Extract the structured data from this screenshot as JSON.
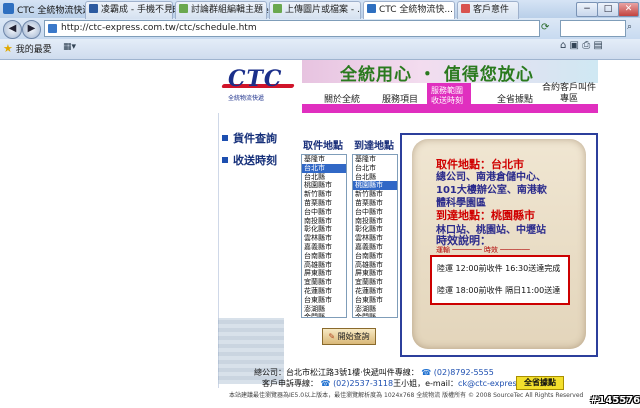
{
  "window": {
    "title": "CTC 全統物流快遞股份有限公司 - 收送時刻表 - Windows Internet Explorer",
    "controls": [
      "−",
      "□",
      "✕"
    ]
  },
  "address_bar": {
    "url": "http://ctc-express.com.tw/ctc/schedule.htm"
  },
  "favorites": {
    "label": "我的最愛"
  },
  "tabs": [
    {
      "label": "凌霸成 - 手機不見 ...",
      "color": "#2c5aa0"
    },
    {
      "label": "討論群組編輯主題 -...",
      "color": "#6aa84f"
    },
    {
      "label": "上傳圖片或檔案 - ...",
      "color": "#6aa84f"
    },
    {
      "label": "CTC 全統物流快...",
      "color": "#2e6fc0",
      "active": true
    },
    {
      "label": "客戶意件",
      "color": "#d9534f"
    }
  ],
  "header": {
    "logo_text": "CTC",
    "logo_subtitle": "全統物流快遞",
    "slogan": "全統用心 ‧ 值得您放心",
    "nav": [
      "關於全統",
      "服務項目",
      "服務範圍",
      "全省據點",
      "合約客戶叫件專區"
    ],
    "nav_selected_index": 2,
    "nav_selected_sub": "收送時刻"
  },
  "sidebar": {
    "items": [
      {
        "label": "貨件查詢"
      },
      {
        "label": "收送時刻"
      }
    ]
  },
  "schedule": {
    "pickup_header": "取件地點",
    "delivery_header": "到達地點",
    "pickup_options": [
      "基隆市",
      "台北市",
      "台北縣",
      "桃園縣市",
      "新竹縣市",
      "苗栗縣市",
      "台中縣市",
      "南投縣市",
      "彰化縣市",
      "雲林縣市",
      "嘉義縣市",
      "台南縣市",
      "高雄縣市",
      "屏東縣市",
      "宜蘭縣市",
      "花蓮縣市",
      "台東縣市",
      "澎湖縣",
      "金門縣"
    ],
    "pickup_selected_index": 1,
    "delivery_options": [
      "基隆市",
      "台北市",
      "台北縣",
      "桃園縣市",
      "新竹縣市",
      "苗栗縣市",
      "台中縣市",
      "南投縣市",
      "彰化縣市",
      "雲林縣市",
      "嘉義縣市",
      "台南縣市",
      "高雄縣市",
      "屏東縣市",
      "宜蘭縣市",
      "花蓮縣市",
      "台東縣市",
      "澎湖縣",
      "金門縣"
    ],
    "delivery_selected_index": 3,
    "search_button": "開始查詢"
  },
  "result": {
    "pickup_line": "取件地點：台北市",
    "pickup_detail_1": "總公司、南港倉儲中心、",
    "pickup_detail_2": "101大樓辦公室、南港軟",
    "pickup_detail_3": "體科學園區",
    "delivery_line": "到達地點：桃園縣市",
    "delivery_detail": "林口站、桃園站、中壢站",
    "time_title": "時效說明：",
    "legend": "運輸 ─────── 時效 ───────",
    "schedule_lines": [
      "陸運 12:00前收件 16:30送達完成",
      "陸運 18:00前收件 隔日11:00送達"
    ]
  },
  "footer": {
    "line1": "總公司：台北市松江路3號1樓‧快遞叫件專線：",
    "phone1": "(02)8792-5555",
    "line2": "客戶申訴專線：",
    "phone2": "(02)2537-3118",
    "line2b": "王小姐，e-mail：",
    "email": "ck@ctc-express.com",
    "line3": "本站建議最佳瀏覽器為IE5.0以上版本，最佳瀏覽解析度為 1024x768  全統物流  版權所有 © 2008 SourceTec All Rights Reserved",
    "whole_button": "全省據點"
  },
  "watermark": "#145576",
  "colors": {
    "nav_highlight": "#e02fbf",
    "panel_border": "#2c3f9c",
    "pickup_red": "#d00000",
    "detail_blue": "#2b2b8c"
  }
}
